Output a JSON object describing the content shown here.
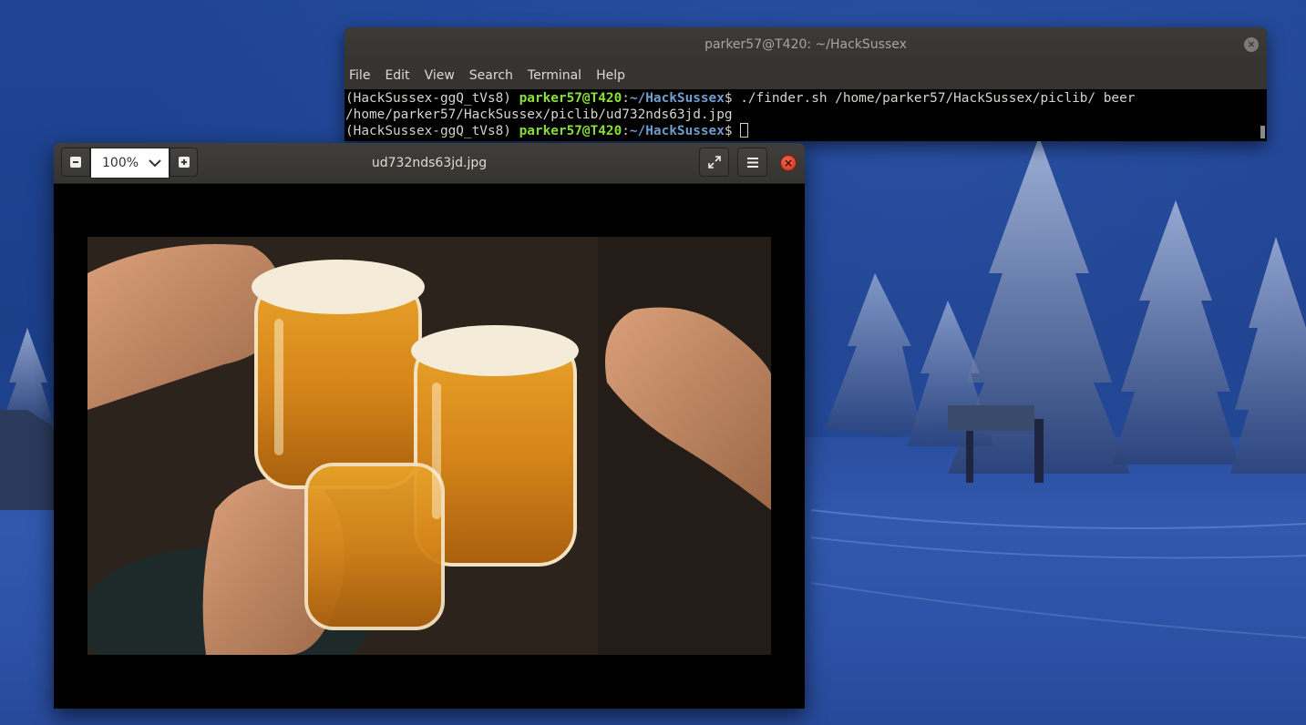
{
  "terminal": {
    "title": "parker57@T420: ~/HackSussex",
    "close_glyph": "×",
    "menu": [
      "File",
      "Edit",
      "View",
      "Search",
      "Terminal",
      "Help"
    ],
    "lines": [
      {
        "env": "(HackSussex-ggQ_tVs8) ",
        "user_host": "parker57@T420",
        "colon": ":",
        "path": "~/HackSussex",
        "prompt": "$ ",
        "command": "./finder.sh /home/parker57/HackSussex/piclib/ beer"
      },
      {
        "output": "/home/parker57/HackSussex/piclib/ud732nds63jd.jpg"
      },
      {
        "env": "(HackSussex-ggQ_tVs8) ",
        "user_host": "parker57@T420",
        "colon": ":",
        "path": "~/HackSussex",
        "prompt": "$ "
      }
    ]
  },
  "viewer": {
    "title": "ud732nds63jd.jpg",
    "zoom_out_glyph": "−",
    "zoom_in_glyph": "+",
    "zoom_value": "100%",
    "close_glyph": "×",
    "icons": {
      "zoom_out": "minus-icon",
      "zoom_in": "plus-icon",
      "dropdown": "chevron-down-icon",
      "fullscreen": "fullscreen-icon",
      "menu": "hamburger-menu-icon",
      "close": "close-icon"
    },
    "image": "photo of hands clinking beer mugs"
  },
  "colors": {
    "terminal_user": "#8ae234",
    "terminal_path": "#729fcf",
    "terminal_text": "#d3d7cf",
    "close_button": "#e0462b",
    "wallpaper_blue": "#1e438f"
  }
}
